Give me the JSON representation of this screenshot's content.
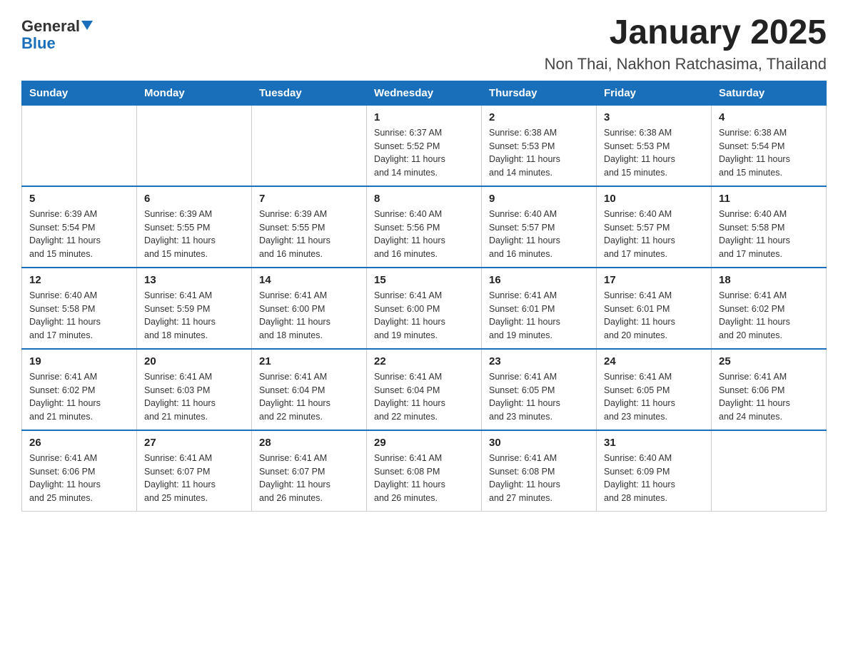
{
  "logo": {
    "general": "General",
    "blue": "Blue"
  },
  "title": "January 2025",
  "location": "Non Thai, Nakhon Ratchasima, Thailand",
  "days_of_week": [
    "Sunday",
    "Monday",
    "Tuesday",
    "Wednesday",
    "Thursday",
    "Friday",
    "Saturday"
  ],
  "weeks": [
    [
      {
        "day": "",
        "info": ""
      },
      {
        "day": "",
        "info": ""
      },
      {
        "day": "",
        "info": ""
      },
      {
        "day": "1",
        "info": "Sunrise: 6:37 AM\nSunset: 5:52 PM\nDaylight: 11 hours\nand 14 minutes."
      },
      {
        "day": "2",
        "info": "Sunrise: 6:38 AM\nSunset: 5:53 PM\nDaylight: 11 hours\nand 14 minutes."
      },
      {
        "day": "3",
        "info": "Sunrise: 6:38 AM\nSunset: 5:53 PM\nDaylight: 11 hours\nand 15 minutes."
      },
      {
        "day": "4",
        "info": "Sunrise: 6:38 AM\nSunset: 5:54 PM\nDaylight: 11 hours\nand 15 minutes."
      }
    ],
    [
      {
        "day": "5",
        "info": "Sunrise: 6:39 AM\nSunset: 5:54 PM\nDaylight: 11 hours\nand 15 minutes."
      },
      {
        "day": "6",
        "info": "Sunrise: 6:39 AM\nSunset: 5:55 PM\nDaylight: 11 hours\nand 15 minutes."
      },
      {
        "day": "7",
        "info": "Sunrise: 6:39 AM\nSunset: 5:55 PM\nDaylight: 11 hours\nand 16 minutes."
      },
      {
        "day": "8",
        "info": "Sunrise: 6:40 AM\nSunset: 5:56 PM\nDaylight: 11 hours\nand 16 minutes."
      },
      {
        "day": "9",
        "info": "Sunrise: 6:40 AM\nSunset: 5:57 PM\nDaylight: 11 hours\nand 16 minutes."
      },
      {
        "day": "10",
        "info": "Sunrise: 6:40 AM\nSunset: 5:57 PM\nDaylight: 11 hours\nand 17 minutes."
      },
      {
        "day": "11",
        "info": "Sunrise: 6:40 AM\nSunset: 5:58 PM\nDaylight: 11 hours\nand 17 minutes."
      }
    ],
    [
      {
        "day": "12",
        "info": "Sunrise: 6:40 AM\nSunset: 5:58 PM\nDaylight: 11 hours\nand 17 minutes."
      },
      {
        "day": "13",
        "info": "Sunrise: 6:41 AM\nSunset: 5:59 PM\nDaylight: 11 hours\nand 18 minutes."
      },
      {
        "day": "14",
        "info": "Sunrise: 6:41 AM\nSunset: 6:00 PM\nDaylight: 11 hours\nand 18 minutes."
      },
      {
        "day": "15",
        "info": "Sunrise: 6:41 AM\nSunset: 6:00 PM\nDaylight: 11 hours\nand 19 minutes."
      },
      {
        "day": "16",
        "info": "Sunrise: 6:41 AM\nSunset: 6:01 PM\nDaylight: 11 hours\nand 19 minutes."
      },
      {
        "day": "17",
        "info": "Sunrise: 6:41 AM\nSunset: 6:01 PM\nDaylight: 11 hours\nand 20 minutes."
      },
      {
        "day": "18",
        "info": "Sunrise: 6:41 AM\nSunset: 6:02 PM\nDaylight: 11 hours\nand 20 minutes."
      }
    ],
    [
      {
        "day": "19",
        "info": "Sunrise: 6:41 AM\nSunset: 6:02 PM\nDaylight: 11 hours\nand 21 minutes."
      },
      {
        "day": "20",
        "info": "Sunrise: 6:41 AM\nSunset: 6:03 PM\nDaylight: 11 hours\nand 21 minutes."
      },
      {
        "day": "21",
        "info": "Sunrise: 6:41 AM\nSunset: 6:04 PM\nDaylight: 11 hours\nand 22 minutes."
      },
      {
        "day": "22",
        "info": "Sunrise: 6:41 AM\nSunset: 6:04 PM\nDaylight: 11 hours\nand 22 minutes."
      },
      {
        "day": "23",
        "info": "Sunrise: 6:41 AM\nSunset: 6:05 PM\nDaylight: 11 hours\nand 23 minutes."
      },
      {
        "day": "24",
        "info": "Sunrise: 6:41 AM\nSunset: 6:05 PM\nDaylight: 11 hours\nand 23 minutes."
      },
      {
        "day": "25",
        "info": "Sunrise: 6:41 AM\nSunset: 6:06 PM\nDaylight: 11 hours\nand 24 minutes."
      }
    ],
    [
      {
        "day": "26",
        "info": "Sunrise: 6:41 AM\nSunset: 6:06 PM\nDaylight: 11 hours\nand 25 minutes."
      },
      {
        "day": "27",
        "info": "Sunrise: 6:41 AM\nSunset: 6:07 PM\nDaylight: 11 hours\nand 25 minutes."
      },
      {
        "day": "28",
        "info": "Sunrise: 6:41 AM\nSunset: 6:07 PM\nDaylight: 11 hours\nand 26 minutes."
      },
      {
        "day": "29",
        "info": "Sunrise: 6:41 AM\nSunset: 6:08 PM\nDaylight: 11 hours\nand 26 minutes."
      },
      {
        "day": "30",
        "info": "Sunrise: 6:41 AM\nSunset: 6:08 PM\nDaylight: 11 hours\nand 27 minutes."
      },
      {
        "day": "31",
        "info": "Sunrise: 6:40 AM\nSunset: 6:09 PM\nDaylight: 11 hours\nand 28 minutes."
      },
      {
        "day": "",
        "info": ""
      }
    ]
  ]
}
